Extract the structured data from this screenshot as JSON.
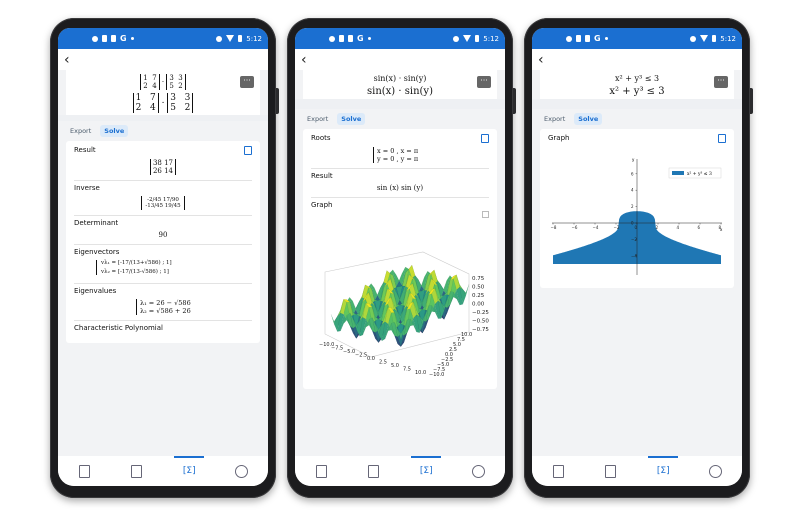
{
  "status": {
    "time": "5:12",
    "g": "G"
  },
  "phone1": {
    "header_small": "[1 7; 2 4] · [3 3; 5 2]",
    "header_big": "[1 7; 2 4] · [3 3; 5 2]",
    "tabs": [
      "Export",
      "Solve"
    ],
    "sections": {
      "result": {
        "title": "Result",
        "rows": [
          "38   17",
          "26   14"
        ]
      },
      "inverse": {
        "title": "Inverse",
        "rows": [
          "-2/45   17/90",
          "-13/45   19/45"
        ]
      },
      "determinant": {
        "title": "Determinant",
        "value": "90"
      },
      "eigenvectors": {
        "title": "Eigenvectors",
        "v1": "vλ₁ = [-17/(13+√586) ; 1]",
        "v2": "vλ₂ = [-17/(13-√586) ; 1]"
      },
      "eigenvalues": {
        "title": "Eigenvalues",
        "l1": "λ₁ = 26 − √586",
        "l2": "λ₂ = √586 + 26"
      },
      "charpoly": {
        "title": "Characteristic Polynomial"
      }
    }
  },
  "phone2": {
    "header_small": "sin(x) · sin(y)",
    "header_big": "sin(x) · sin(y)",
    "tabs": [
      "Export",
      "Solve"
    ],
    "roots_title": "Roots",
    "roots_row1": "x = 0 ,    x = π",
    "roots_row2": "y = 0 ,    y = π",
    "result_title": "Result",
    "result_value": "sin (x) sin (y)",
    "graph_title": "Graph",
    "z_ticks": [
      "0.75",
      "0.50",
      "0.25",
      "0.00",
      "−0.25",
      "−0.50",
      "−0.75"
    ],
    "y_ticks": [
      "10.0",
      "7.5",
      "5.0",
      "2.5",
      "0.0",
      "−2.5",
      "−5.0",
      "−7.5",
      "−10.0"
    ],
    "x_ticks": [
      "−10.0",
      "−7.5",
      "−5.0",
      "−2.5",
      "0.0",
      "2.5",
      "5.0",
      "7.5",
      "10.0"
    ]
  },
  "phone3": {
    "header_small": "x² + y³ ≤ 3",
    "header_big": "x² + y³ ≤ 3",
    "tabs": [
      "Export",
      "Solve"
    ],
    "graph_title": "Graph",
    "legend": "x² + y³ ≤ 3",
    "x_ticks": [
      "−8",
      "−6",
      "−4",
      "−2",
      "0",
      "2",
      "4",
      "6",
      "8"
    ],
    "y_ticks": [
      "6",
      "4",
      "2",
      "0",
      "−2",
      "−4"
    ],
    "x_axis": "x",
    "y_axis": "y"
  },
  "colors": {
    "accent": "#1b6fd1",
    "fill": "#1f77b4"
  }
}
